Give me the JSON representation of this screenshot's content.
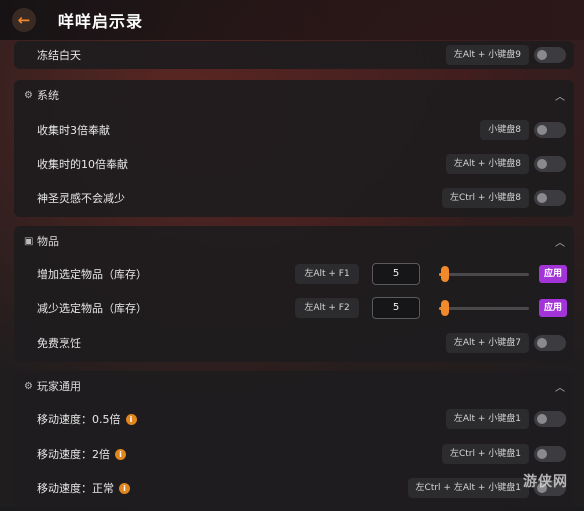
{
  "header": {
    "title": "咩咩启示录",
    "back_icon": "←"
  },
  "top_row": {
    "label": "冻结白天",
    "hotkey": "左Alt + 小键盘9"
  },
  "sections": {
    "system": {
      "title": "系统",
      "rows": [
        {
          "label": "收集时3倍奉献",
          "hotkey": "小键盘8"
        },
        {
          "label": "收集时的10倍奉献",
          "hotkey": "左Alt + 小键盘8"
        },
        {
          "label": "神圣灵感不会减少",
          "hotkey": "左Ctrl + 小键盘8"
        }
      ]
    },
    "items": {
      "title": "物品",
      "rows": [
        {
          "label": "增加选定物品（库存）",
          "hotkey": "左Alt + F1",
          "value": "5",
          "slider_fraction": 0.05,
          "apply": "应用"
        },
        {
          "label": "减少选定物品（库存）",
          "hotkey": "左Alt + F2",
          "value": "5",
          "slider_fraction": 0.05,
          "apply": "应用"
        },
        {
          "label": "免费烹饪",
          "hotkey": "左Alt + 小键盘7"
        }
      ]
    },
    "player": {
      "title": "玩家通用",
      "rows": [
        {
          "label": "移动速度：0.5倍",
          "hotkey": "左Alt + 小键盘1"
        },
        {
          "label": "移动速度：2倍",
          "hotkey": "左Ctrl + 小键盘1"
        },
        {
          "label": "移动速度：正常",
          "hotkey": "左Ctrl + 左Alt + 小键盘1"
        }
      ]
    }
  },
  "watermark": "游侠网",
  "colors": {
    "accent": "#f08a2c",
    "apply": "#a334d8",
    "info": "#e0861f"
  }
}
